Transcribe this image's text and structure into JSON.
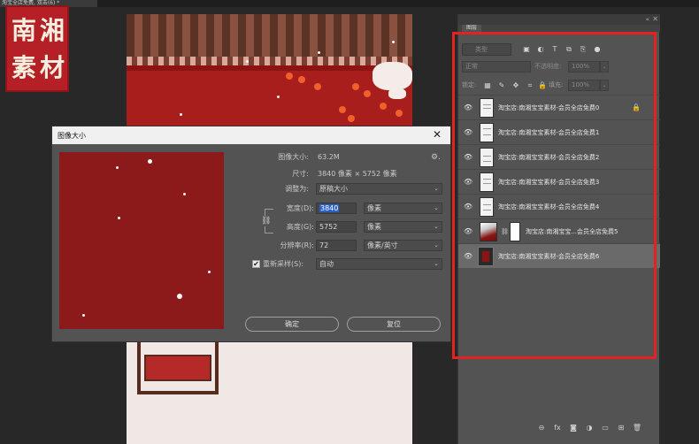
{
  "document_tab": {
    "label": "淘宝全店免费, 双击(6) *"
  },
  "logo": {
    "chars": [
      "南",
      "湘",
      "素",
      "材"
    ],
    "heart": "♥"
  },
  "dialog": {
    "title": "图像大小",
    "close_glyph": "✕",
    "image_size_label": "图像大小:",
    "image_size_value": "63.2M",
    "gear_glyph": "⚙.",
    "dimensions_label": "尺寸:",
    "dimensions_value": "3840 像素 × 5752 像素",
    "fit_label": "调整为:",
    "fit_value": "原稿大小",
    "width_label": "宽度(D):",
    "width_value": "3840",
    "width_unit": "像素",
    "height_label": "高度(G):",
    "height_value": "5752",
    "height_unit": "像素",
    "resolution_label": "分辨率(R):",
    "resolution_value": "72",
    "resolution_unit": "像素/英寸",
    "resample_label": "重新采样(S):",
    "resample_checked": "✔",
    "resample_value": "自动",
    "ok_label": "确定",
    "reset_label": "复位",
    "caret": "⌄"
  },
  "layers_panel": {
    "tab_label": "图层",
    "collapse_glyph": "«",
    "close_glyph": "✕",
    "filter_placeholder": "类型",
    "filter_icons": [
      "image-icon",
      "adjustment-icon",
      "type-icon",
      "shape-icon",
      "smart-object-icon",
      "dot-icon"
    ],
    "blend_mode": "正常",
    "opacity_label": "不透明度:",
    "opacity_value": "100%",
    "lock_label": "锁定:",
    "fill_label": "填充:",
    "fill_value": "100%",
    "caret": "⌄",
    "layers": [
      {
        "name": "淘宝店:南湘宝宝素材-会员全店免费0",
        "visible": true,
        "locked": true
      },
      {
        "name": "淘宝店:南湘宝宝素材-会员全店免费1",
        "visible": true
      },
      {
        "name": "淘宝店:南湘宝宝素材-会员全店免费2",
        "visible": true
      },
      {
        "name": "淘宝店:南湘宝宝素材-会员全店免费3",
        "visible": true
      },
      {
        "name": "淘宝店:南湘宝宝素材-会员全店免费4",
        "visible": true
      },
      {
        "name": "淘宝店:南湘宝宝...会员全店免费5",
        "visible": true,
        "masked": true
      },
      {
        "name": "淘宝店:南湘宝宝素材-会员全店免费6",
        "visible": true,
        "active": true
      }
    ],
    "bottom_icons": [
      "link-layers-icon",
      "fx-icon",
      "add-mask-icon",
      "adjustment-layer-icon",
      "group-icon",
      "new-layer-icon",
      "delete-layer-icon"
    ]
  }
}
